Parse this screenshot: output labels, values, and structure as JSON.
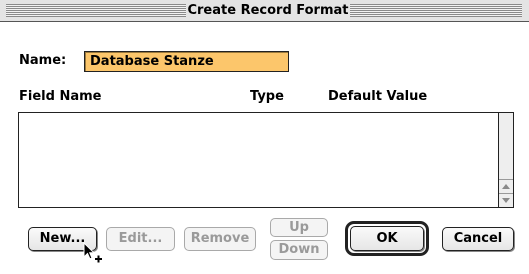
{
  "window": {
    "title": "Create Record Format"
  },
  "form": {
    "name_label": "Name:",
    "name_value": "Database Stanze"
  },
  "list": {
    "columns": [
      "Field Name",
      "Type",
      "Default Value"
    ],
    "rows": []
  },
  "buttons": {
    "new": "New...",
    "edit": "Edit...",
    "remove": "Remove",
    "up": "Up",
    "down": "Down",
    "ok": "OK",
    "cancel": "Cancel"
  },
  "colors": {
    "name_field_bg": "#fcc66b",
    "disabled_text": "#9a9a9a"
  },
  "icons": {
    "cursor": "copy-arrow-cursor",
    "scroll_up": "scroll-up-arrow",
    "scroll_down": "scroll-down-arrow"
  }
}
